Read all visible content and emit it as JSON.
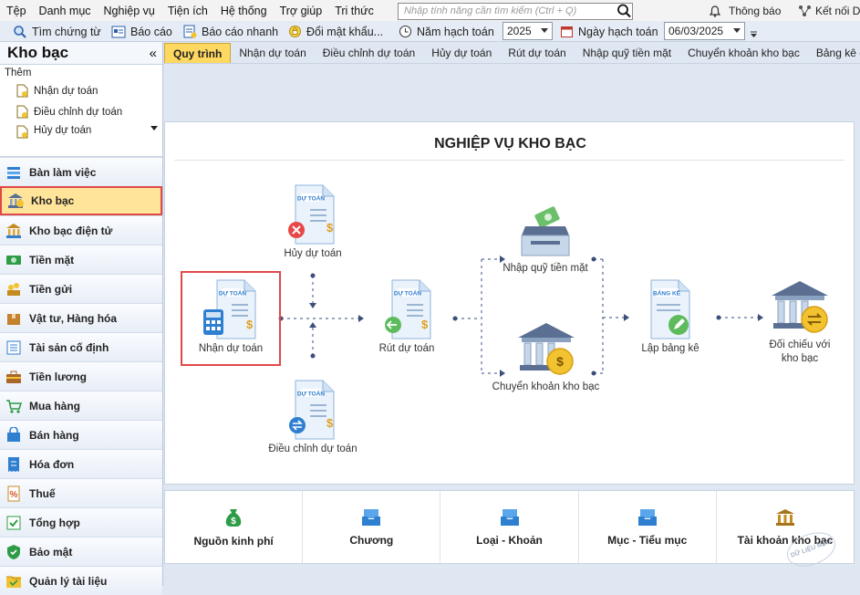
{
  "menu": [
    "Tệp",
    "Danh mục",
    "Nghiệp vụ",
    "Tiện ích",
    "Hệ thống",
    "Trợ giúp",
    "Tri thức"
  ],
  "search": {
    "placeholder": "Nhập tính năng cần tìm kiếm (Ctrl + Q)"
  },
  "topright": {
    "notify": "Thông báo",
    "connect": "Kết nối DV"
  },
  "toolbar": {
    "find_voucher": "Tìm chứng từ",
    "report": "Báo cáo",
    "quick_report": "Báo cáo nhanh",
    "change_password": "Đổi mật khẩu...",
    "fiscal_year_label": "Năm hạch toán",
    "fiscal_year_value": "2025",
    "posting_date_label": "Ngày hạch toán",
    "posting_date_value": "06/03/2025"
  },
  "sidebar": {
    "title": "Kho bạc",
    "collapse": "«",
    "add_label": "Thêm",
    "sub_items": [
      "Nhận dự toán",
      "Điều chỉnh dự toán",
      "Hủy dự toán"
    ],
    "nav": [
      {
        "label": "Bàn làm việc",
        "icon": "desk-icon"
      },
      {
        "label": "Kho bạc",
        "icon": "treasury-icon",
        "active": true
      },
      {
        "label": "Kho bạc điện tử",
        "icon": "e-treasury-icon"
      },
      {
        "label": "Tiền mặt",
        "icon": "cash-icon"
      },
      {
        "label": "Tiền gửi",
        "icon": "deposit-icon"
      },
      {
        "label": "Vật tư, Hàng hóa",
        "icon": "goods-icon"
      },
      {
        "label": "Tài sản cố định",
        "icon": "fixed-asset-icon"
      },
      {
        "label": "Tiền lương",
        "icon": "salary-icon"
      },
      {
        "label": "Mua hàng",
        "icon": "cart-icon"
      },
      {
        "label": "Bán hàng",
        "icon": "sales-icon"
      },
      {
        "label": "Hóa đơn",
        "icon": "invoice-icon"
      },
      {
        "label": "Thuế",
        "icon": "tax-icon"
      },
      {
        "label": "Tổng hợp",
        "icon": "summary-icon"
      },
      {
        "label": "Bảo mật",
        "icon": "security-icon"
      },
      {
        "label": "Quản lý tài liệu",
        "icon": "document-icon"
      }
    ]
  },
  "tabs": [
    "Quy trình",
    "Nhận dự toán",
    "Điều chỉnh dự toán",
    "Hủy dự toán",
    "Rút dự toán",
    "Nhập quỹ tiền mặt",
    "Chuyển khoản kho bạc",
    "Bảng kê chứng từ thanh"
  ],
  "process": {
    "title": "NGHIỆP VỤ KHO BẠC",
    "doc_badge": "DỰ TOÁN",
    "list_badge": "BẢNG KÊ",
    "cancel": "Hủy dự toán",
    "receive": "Nhận dự toán",
    "adjust": "Điều chỉnh dự toán",
    "withdraw": "Rút dự toán",
    "cash_in": "Nhập quỹ tiền mặt",
    "transfer": "Chuyển khoản kho bạc",
    "make_list": "Lập bảng kê",
    "reconcile": "Đối chiếu với kho bạc"
  },
  "categories": [
    "Nguồn kinh phí",
    "Chương",
    "Loại - Khoản",
    "Mục - Tiểu mục",
    "Tài khoản kho bạc"
  ],
  "watermark": "DỮ LIỆU MẪU",
  "colors": {
    "accent": "#ffd862",
    "highlight": "#e04848",
    "icon_blue": "#2f7fd0",
    "icon_green": "#2e9b46",
    "icon_gold": "#f2c230"
  }
}
